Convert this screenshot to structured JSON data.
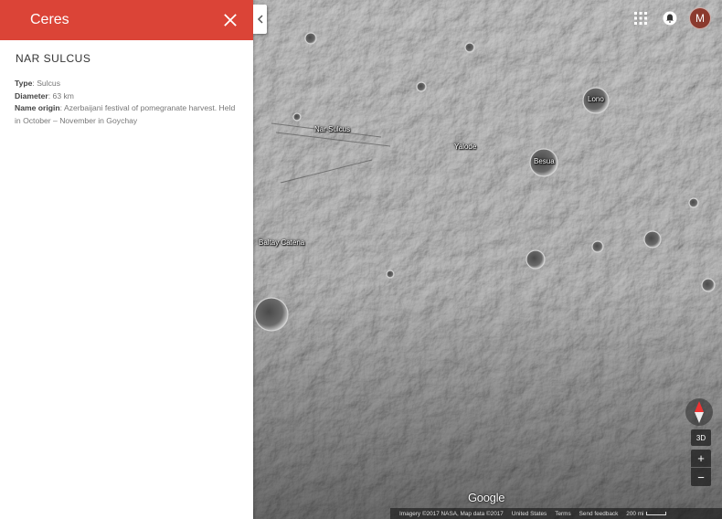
{
  "panel": {
    "title": "Ceres",
    "feature_name": "NAR SULCUS",
    "properties": [
      {
        "label": "Type",
        "value": ": Sulcus"
      },
      {
        "label": "Diameter",
        "value": ": 63 km"
      },
      {
        "label": "Name origin",
        "value": ": Azerbaijani festival of pomegranate harvest. Held in October – November in Goychay"
      }
    ]
  },
  "map": {
    "labels": {
      "lono": "Lono",
      "nar_sulcus": "Nar Sulcus",
      "yalode": "Yalode",
      "besua": "Besua",
      "baltay_catena": "Baltay Catena"
    },
    "account_initial": "M",
    "btn_3d": "3D",
    "zoom_in": "+",
    "zoom_out": "−",
    "logo_text": "Google",
    "footer": {
      "imagery": "Imagery ©2017 NASA, Map data ©2017",
      "region": "United States",
      "terms": "Terms",
      "feedback": "Send feedback",
      "scale": "200 mi"
    }
  },
  "colors": {
    "header_red": "#db4437",
    "surface_gray": "#7a7a7a"
  },
  "icons": [
    "close-icon",
    "chevron-left-icon",
    "apps-grid-icon",
    "notifications-icon",
    "compass-icon"
  ]
}
